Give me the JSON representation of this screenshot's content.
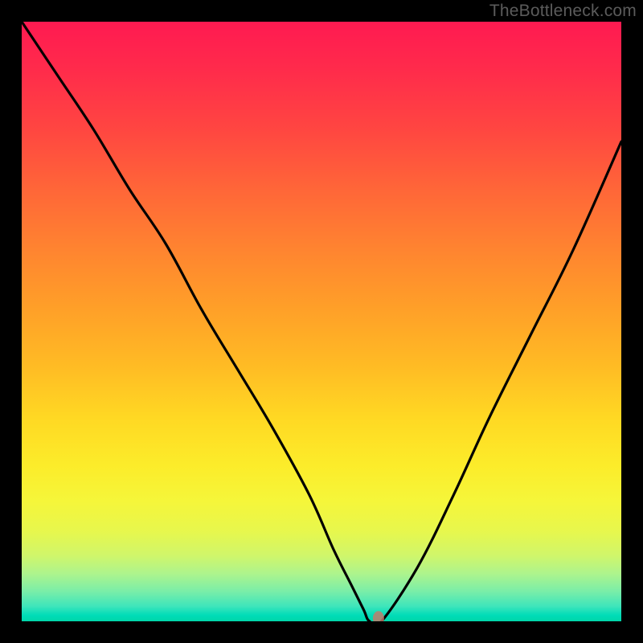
{
  "watermark_text": "TheBottleneck.com",
  "chart_data": {
    "type": "line",
    "title": "",
    "xlabel": "",
    "ylabel": "",
    "xlim": [
      0,
      100
    ],
    "ylim": [
      0,
      100
    ],
    "series": [
      {
        "name": "bottleneck-curve",
        "x": [
          0,
          6,
          12,
          18,
          24,
          30,
          36,
          42,
          48,
          52,
          55,
          57,
          58,
          60,
          66,
          72,
          78,
          85,
          92,
          100
        ],
        "values": [
          100,
          91,
          82,
          72,
          63,
          52,
          42,
          32,
          21,
          12,
          6,
          2,
          0,
          0,
          9,
          21,
          34,
          48,
          62,
          80
        ]
      }
    ],
    "marker": {
      "x": 59.5,
      "y": 0.5
    },
    "gradient_stops": [
      {
        "pos": 0,
        "color": "#ff1a51"
      },
      {
        "pos": 0.18,
        "color": "#ff4641"
      },
      {
        "pos": 0.38,
        "color": "#ff8430"
      },
      {
        "pos": 0.58,
        "color": "#ffbd24"
      },
      {
        "pos": 0.74,
        "color": "#fcec2a"
      },
      {
        "pos": 0.89,
        "color": "#d0f66a"
      },
      {
        "pos": 1.0,
        "color": "#00d6a9"
      }
    ]
  }
}
